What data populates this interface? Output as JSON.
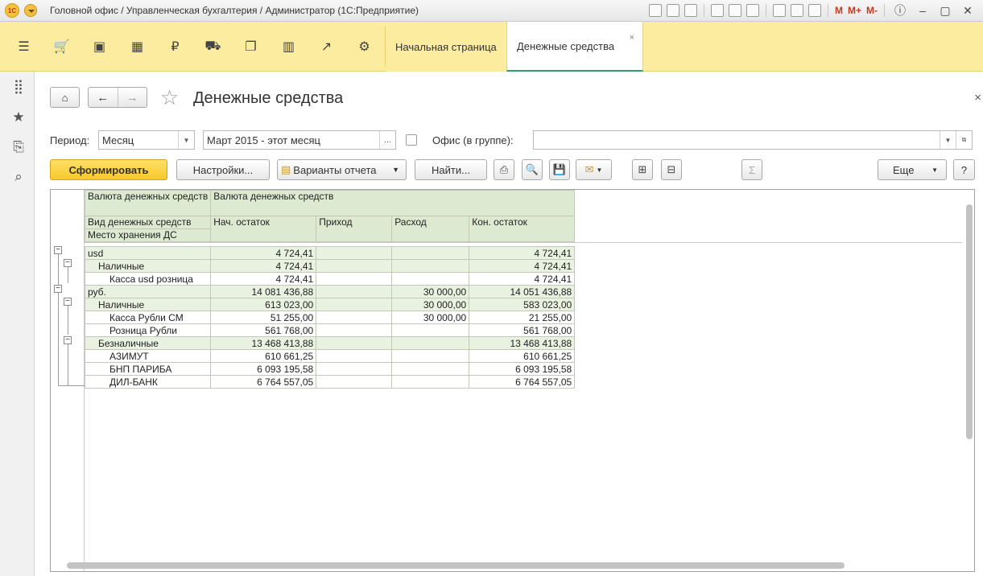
{
  "window": {
    "title": "Головной офис / Управленческая бухгалтерия / Администратор  (1С:Предприятие)",
    "logo": "1С",
    "toolbar_letters": [
      "M",
      "M+",
      "M-"
    ]
  },
  "sections": {
    "icons": [
      "menu-icon",
      "cart-icon",
      "bag-icon",
      "grid-icon",
      "ruble-icon",
      "truck-icon",
      "documents-icon",
      "chart-icon",
      "trend-icon",
      "gear-icon"
    ]
  },
  "tabs": [
    {
      "label": "Начальная страница"
    },
    {
      "label": "Денежные средства",
      "close": "×"
    }
  ],
  "page": {
    "title": "Денежные средства",
    "close": "×"
  },
  "filters": {
    "period_label": "Период:",
    "period_value": "Месяц",
    "period_range": "Март 2015 - этот месяц",
    "ellipsis": "...",
    "office_label": "Офис (в группе):",
    "office_value": ""
  },
  "toolbar": {
    "generate": "Сформировать",
    "settings": "Настройки...",
    "variants": "Варианты отчета",
    "find": "Найти...",
    "more": "Еще",
    "help": "?",
    "sum": "Σ"
  },
  "report": {
    "headers": {
      "row_dim1": "Валюта денежных средств",
      "row_dim2": "Вид денежных средств",
      "row_dim3": "Место хранения ДС",
      "col_group": "Валюта денежных средств",
      "col_start": "Нач. остаток",
      "col_in": "Приход",
      "col_out": "Расход",
      "col_end": "Кон. остаток"
    },
    "rows": [
      {
        "name": "usd",
        "level": 0,
        "start": "4 724,41",
        "in": "",
        "out": "",
        "end": "4 724,41"
      },
      {
        "name": "Наличные",
        "level": 1,
        "start": "4 724,41",
        "in": "",
        "out": "",
        "end": "4 724,41"
      },
      {
        "name": "Касса usd розница",
        "level": 2,
        "start": "4 724,41",
        "in": "",
        "out": "",
        "end": "4 724,41"
      },
      {
        "name": "руб.",
        "level": 0,
        "start": "14 081 436,88",
        "in": "",
        "out": "30 000,00",
        "end": "14 051 436,88"
      },
      {
        "name": "Наличные",
        "level": 1,
        "start": "613 023,00",
        "in": "",
        "out": "30 000,00",
        "end": "583 023,00"
      },
      {
        "name": "Касса Рубли СМ",
        "level": 2,
        "start": "51 255,00",
        "in": "",
        "out": "30 000,00",
        "end": "21 255,00"
      },
      {
        "name": "Розница Рубли",
        "level": 2,
        "start": "561 768,00",
        "in": "",
        "out": "",
        "end": "561 768,00"
      },
      {
        "name": "Безналичные",
        "level": 1,
        "start": "13 468 413,88",
        "in": "",
        "out": "",
        "end": "13 468 413,88"
      },
      {
        "name": "АЗИМУТ",
        "level": 2,
        "start": "610 661,25",
        "in": "",
        "out": "",
        "end": "610 661,25"
      },
      {
        "name": "БНП ПАРИБА",
        "level": 2,
        "start": "6 093 195,58",
        "in": "",
        "out": "",
        "end": "6 093 195,58"
      },
      {
        "name": "ДИЛ-БАНК",
        "level": 2,
        "start": "6 764 557,05",
        "in": "",
        "out": "",
        "end": "6 764 557,05"
      }
    ]
  },
  "colors": {
    "section_bg": "#fbeca0",
    "accent_green": "#2e9d6b",
    "header_green": "#dde9d0",
    "group_green": "#e9f2e0",
    "generate_yellow": "#f8c82c"
  }
}
